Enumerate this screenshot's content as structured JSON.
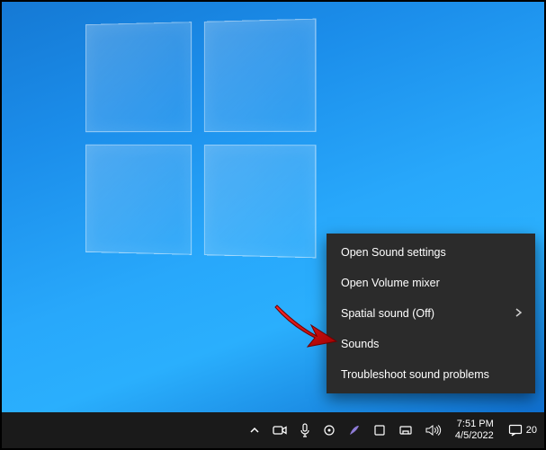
{
  "context_menu": {
    "items": [
      {
        "label": "Open Sound settings",
        "has_submenu": false
      },
      {
        "label": "Open Volume mixer",
        "has_submenu": false
      },
      {
        "label": "Spatial sound (Off)",
        "has_submenu": true
      },
      {
        "label": "Sounds",
        "has_submenu": false
      },
      {
        "label": "Troubleshoot sound problems",
        "has_submenu": false
      }
    ]
  },
  "taskbar": {
    "time": "7:51 PM",
    "date": "4/5/2022",
    "action_center_count": "20"
  },
  "annotation": {
    "arrow_color": "#d40000",
    "arrow_target": "Sounds"
  }
}
